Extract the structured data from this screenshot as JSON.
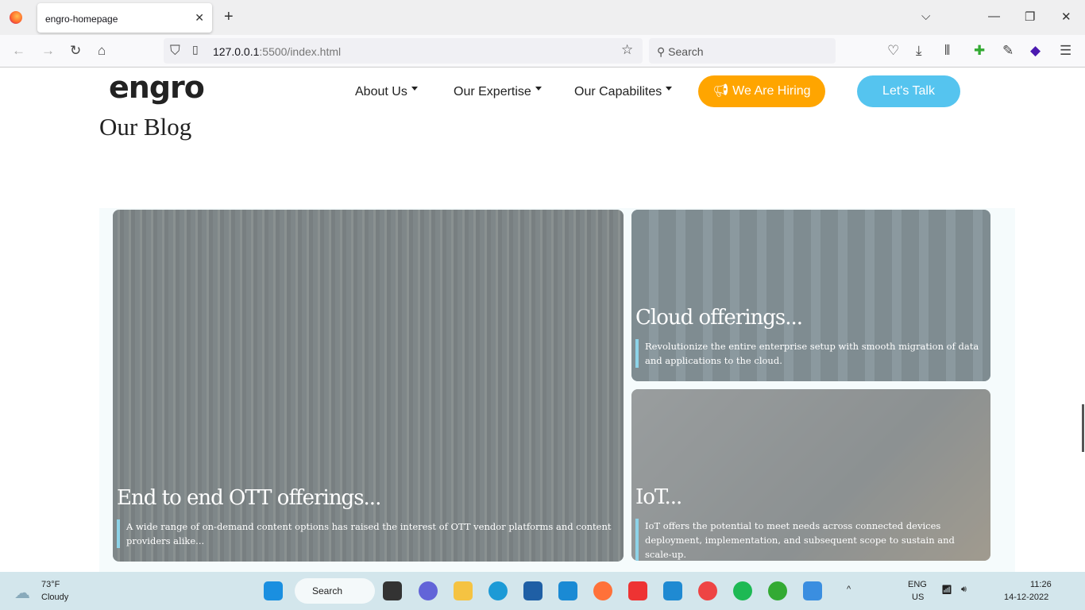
{
  "browser": {
    "tab_title": "engro-homepage",
    "url_host": "127.0.0.1",
    "url_rest": ":5500/index.html",
    "search_placeholder": "Search"
  },
  "site": {
    "logo": "engro",
    "nav": [
      "About Us",
      "Our Expertise",
      "Our Capabilites"
    ],
    "hire_label": "We Are Hiring",
    "talk_label": "Let's Talk",
    "section_title": "Our Blog",
    "colors": {
      "hire": "#ffa500",
      "talk": "#55c4ef",
      "accent_bar": "#8dd3e8"
    },
    "cards": [
      {
        "title": "End to end OTT offerings...",
        "text": "A wide range of on-demand content options has raised the interest of OTT vendor platforms and content providers alike..."
      },
      {
        "title": "Cloud offerings...",
        "text": "Revolutionize the entire enterprise setup with smooth migration of data and applications to the cloud."
      },
      {
        "title": "IoT...",
        "text": "IoT offers the potential to meet needs across connected devices deployment, implementation, and subsequent scope to sustain and scale-up."
      }
    ]
  },
  "taskbar": {
    "temp": "73°F",
    "weather": "Cloudy",
    "search": "Search",
    "lang": "ENG",
    "region": "US",
    "time": "11:26",
    "date": "14-12-2022"
  }
}
